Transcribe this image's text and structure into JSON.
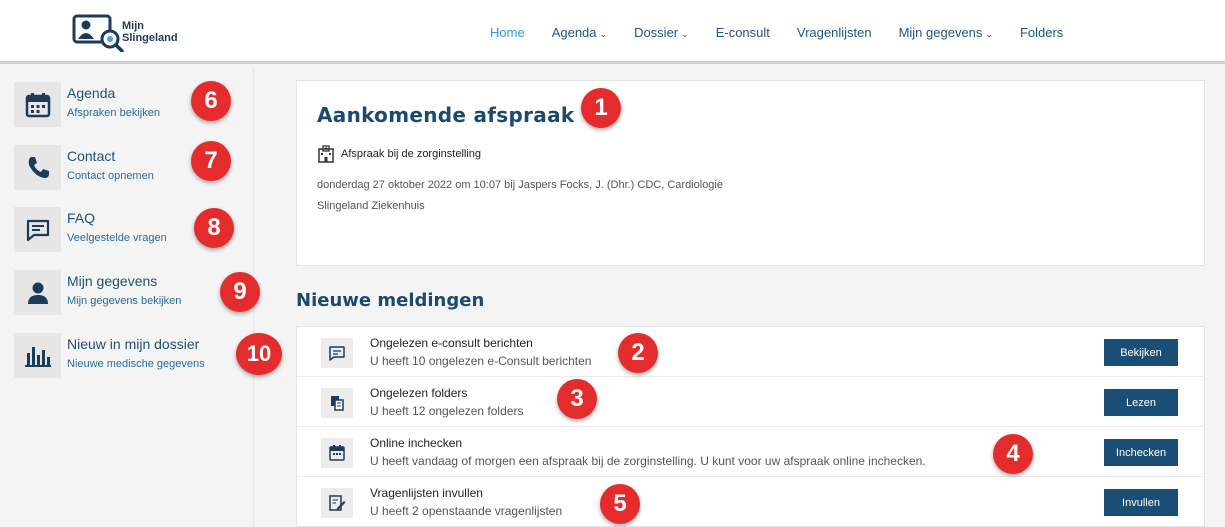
{
  "header": {
    "logo_line1": "Mijn",
    "logo_line2": "Slingeland",
    "nav": [
      {
        "label": "Home",
        "dropdown": false,
        "active": true
      },
      {
        "label": "Agenda",
        "dropdown": true,
        "active": false
      },
      {
        "label": "Dossier",
        "dropdown": true,
        "active": false
      },
      {
        "label": "E-consult",
        "dropdown": false,
        "active": false
      },
      {
        "label": "Vragenlijsten",
        "dropdown": false,
        "active": false
      },
      {
        "label": "Mijn gegevens",
        "dropdown": true,
        "active": false
      },
      {
        "label": "Folders",
        "dropdown": false,
        "active": false
      }
    ]
  },
  "sidebar": {
    "items": [
      {
        "title": "Agenda",
        "subtitle": "Afspraken bekijken",
        "icon": "calendar-icon",
        "badge": "6"
      },
      {
        "title": "Contact",
        "subtitle": "Contact opnemen",
        "icon": "phone-icon",
        "badge": "7"
      },
      {
        "title": "FAQ",
        "subtitle": "Veelgestelde vragen",
        "icon": "chat-icon",
        "badge": "8"
      },
      {
        "title": "Mijn gegevens",
        "subtitle": "Mijn gegevens bekijken",
        "icon": "person-icon",
        "badge": "9"
      },
      {
        "title": "Nieuw in mijn dossier",
        "subtitle": "Nieuwe medische gegevens",
        "icon": "chart-icon",
        "badge": "10"
      }
    ]
  },
  "appointment": {
    "title": "Aankomende afspraak",
    "badge": "1",
    "type": "Afspraak bij de zorginstelling",
    "details": "donderdag 27 oktober 2022 om 10:07 bij Jaspers Focks, J. (Dhr.) CDC, Cardiologie",
    "location": "Slingeland Ziekenhuis"
  },
  "notifications": {
    "title": "Nieuwe meldingen",
    "items": [
      {
        "title": "Ongelezen e-consult berichten",
        "description": "U heeft 10 ongelezen e-Consult berichten",
        "button": "Bekijken",
        "icon": "message-icon",
        "badge": "2"
      },
      {
        "title": "Ongelezen folders",
        "description": "U heeft 12 ongelezen folders",
        "button": "Lezen",
        "icon": "documents-icon",
        "badge": "3"
      },
      {
        "title": "Online inchecken",
        "description": "U heeft vandaag of morgen een afspraak bij de zorginstelling. U kunt voor uw afspraak online inchecken.",
        "button": "Inchecken",
        "icon": "calendar-check-icon",
        "badge": "4"
      },
      {
        "title": "Vragenlijsten invullen",
        "description": "U heeft 2 openstaande vragenlijsten",
        "button": "Invullen",
        "icon": "form-edit-icon",
        "badge": "5"
      }
    ]
  },
  "colors": {
    "primary": "#1b4e74",
    "link": "#22557f",
    "active_nav": "#2d9cdb",
    "badge": "#e52c2c"
  }
}
